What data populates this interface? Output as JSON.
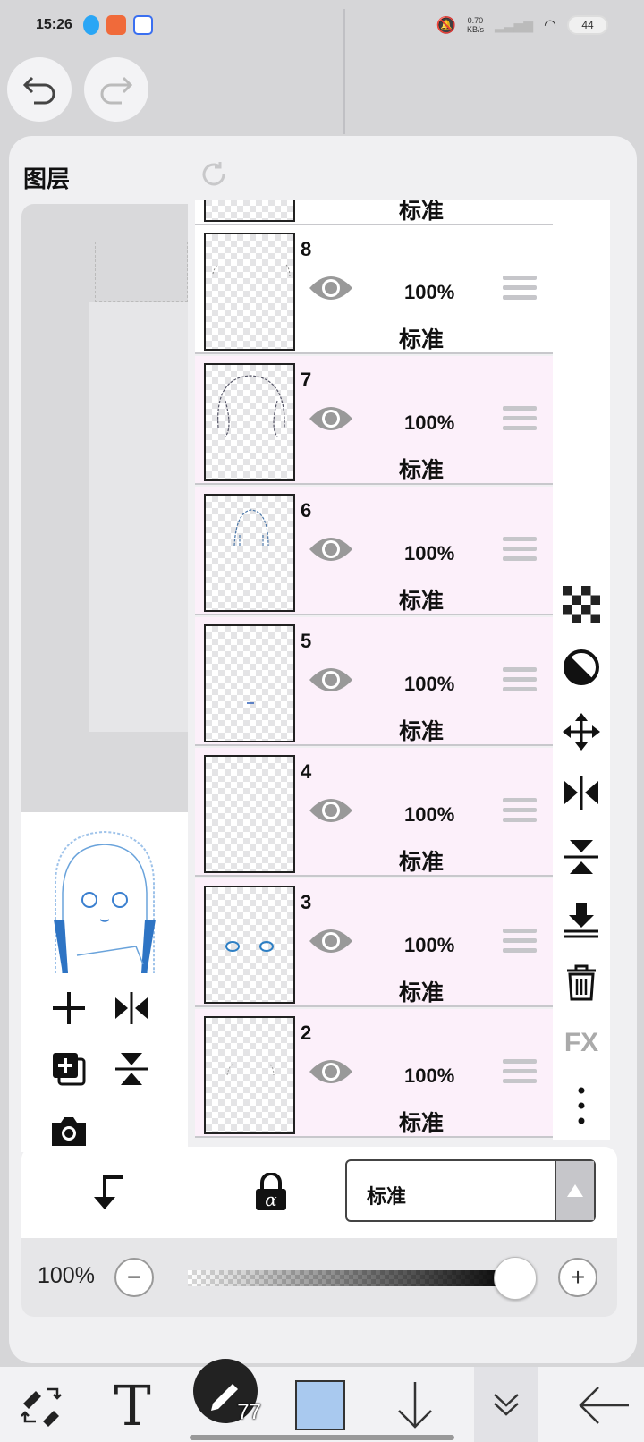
{
  "status_bar": {
    "time": "15:26",
    "net_speed": "0.70",
    "net_unit": "KB/s",
    "battery": "44"
  },
  "panel": {
    "title": "图层"
  },
  "layers": [
    {
      "number": "8",
      "opacity": "100%",
      "blend": "标准"
    },
    {
      "number": "7",
      "opacity": "100%",
      "blend": "标准"
    },
    {
      "number": "6",
      "opacity": "100%",
      "blend": "标准"
    },
    {
      "number": "5",
      "opacity": "100%",
      "blend": "标准"
    },
    {
      "number": "4",
      "opacity": "100%",
      "blend": "标准"
    },
    {
      "number": "3",
      "opacity": "100%",
      "blend": "标准"
    },
    {
      "number": "2",
      "opacity": "100%",
      "blend": "标准"
    }
  ],
  "partial_top_layer": {
    "blend": "标准"
  },
  "right_tools": [
    "checker-icon",
    "half-circle-icon",
    "move-icon",
    "flip-horizontal-icon",
    "flip-vertical-icon",
    "merge-down-icon",
    "trash-icon",
    "fx-icon",
    "more-icon"
  ],
  "fx_label": "FX",
  "controls": {
    "blend_mode": "标准",
    "opacity_label": "100%",
    "opacity_value": 1.0
  },
  "toolbar": {
    "text_tool": "T",
    "brush_size": "77",
    "color": "#a9c9ef"
  }
}
